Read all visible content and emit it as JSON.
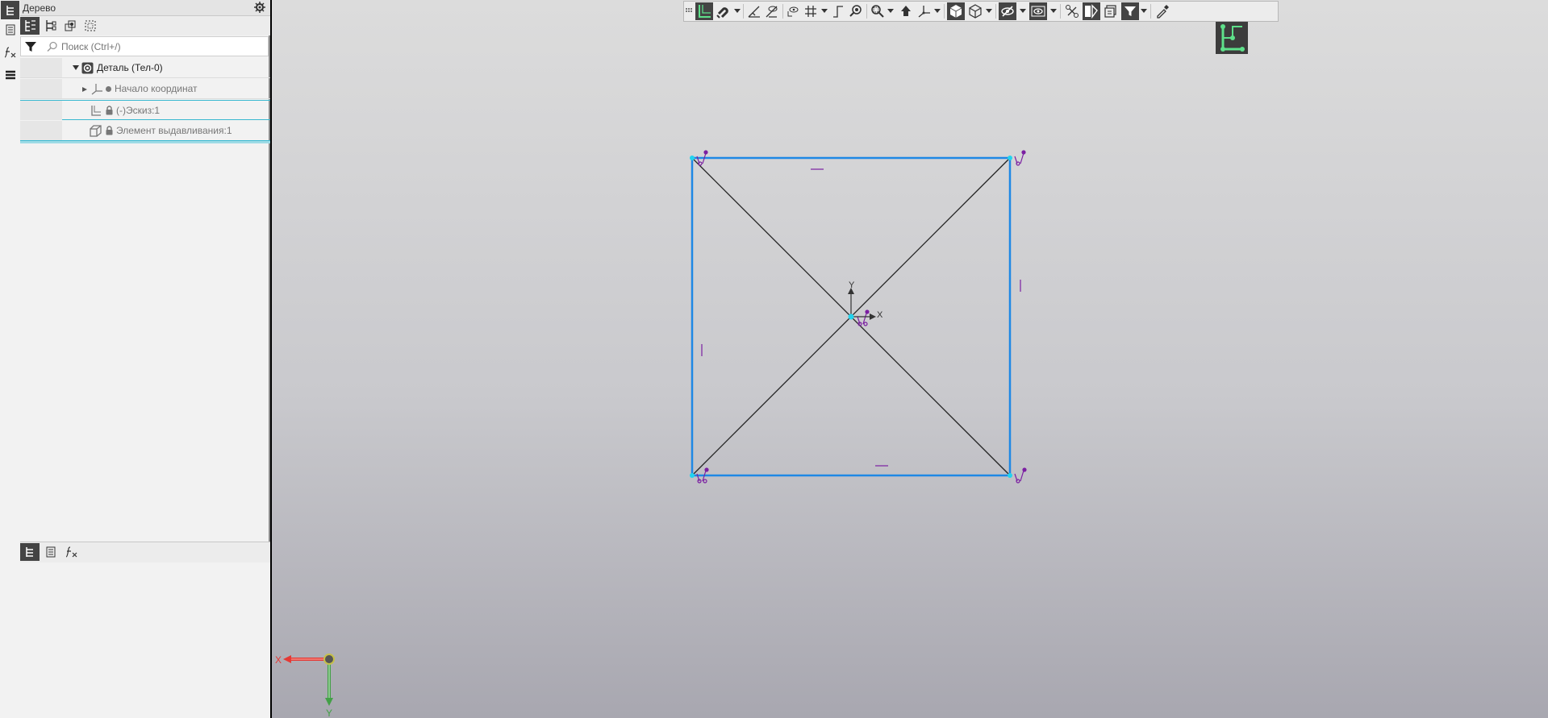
{
  "panel": {
    "title": "Дерево",
    "search_placeholder": "Поиск (Ctrl+/)"
  },
  "tree": {
    "items": [
      {
        "label": "Деталь (Тел-0)",
        "color": "#222222"
      },
      {
        "label": "Начало координат",
        "color": "#777777"
      },
      {
        "label": "(-)Эскиз:1",
        "color": "#777777"
      },
      {
        "label": "Элемент выдавливания:1",
        "color": "#777777"
      }
    ]
  },
  "viewport": {
    "sketch_axis_x": "X",
    "sketch_axis_y": "Y",
    "triad_x": "X",
    "triad_y": "Y"
  },
  "colors": {
    "sketch_edge": "#1e88e5",
    "diagonal": "#222222",
    "constraint": "#7b1fa2",
    "vertex": "#22d3ee",
    "triad_x": "#e53935",
    "triad_y": "#43a047",
    "sketch_mode_icon": "#5ee08a"
  }
}
